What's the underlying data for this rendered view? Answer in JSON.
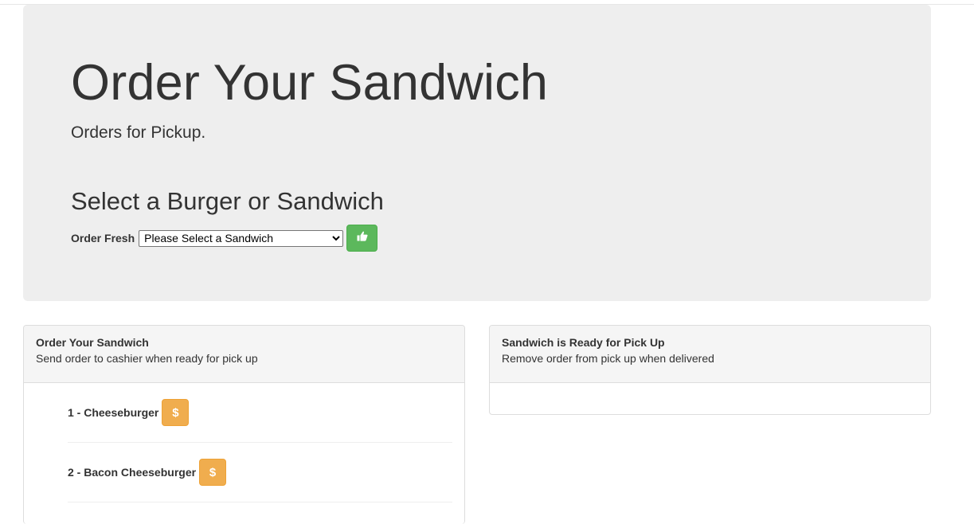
{
  "header": {
    "title": "Order Your Sandwich",
    "subtitle": "Orders for Pickup.",
    "select_heading": "Select a Burger or Sandwich",
    "order_label": "Order Fresh",
    "select_value": "Please Select a Sandwich",
    "submit_icon": "thumbs-up-icon"
  },
  "panels": {
    "order": {
      "title": "Order Your Sandwich",
      "subtitle": "Send order to cashier when ready for pick up",
      "items": [
        {
          "label": "1 - Cheeseburger",
          "button_glyph": "$",
          "button_icon": "dollar-icon"
        },
        {
          "label": "2 - Bacon Cheeseburger",
          "button_glyph": "$",
          "button_icon": "dollar-icon"
        }
      ]
    },
    "ready": {
      "title": "Sandwich is Ready for Pick Up",
      "subtitle": "Remove order from pick up when delivered"
    }
  },
  "colors": {
    "jumbotron_bg": "#eeeeee",
    "success": "#5cb85c",
    "warning": "#f0ad4e",
    "panel_heading_bg": "#f5f5f5"
  }
}
